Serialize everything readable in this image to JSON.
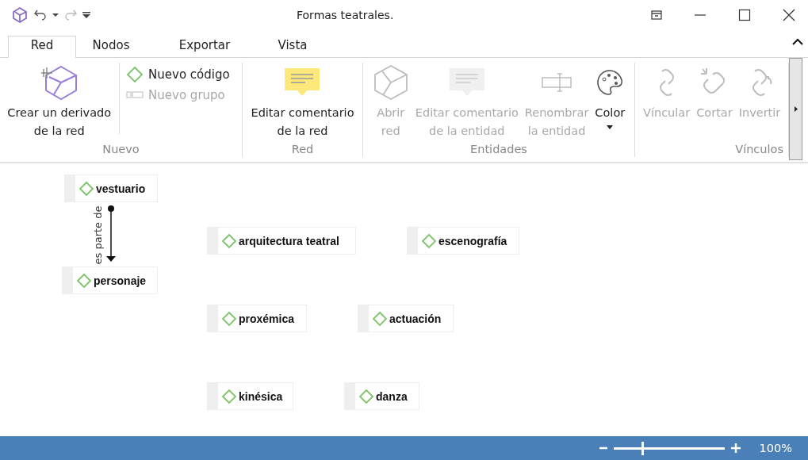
{
  "window": {
    "title": "Formas teatrales."
  },
  "tabs": [
    {
      "label": "Red",
      "selected": true
    },
    {
      "label": "Nodos",
      "selected": false
    },
    {
      "label": "Exportar",
      "selected": false
    },
    {
      "label": "Vista",
      "selected": false
    }
  ],
  "ribbon": {
    "groups": [
      {
        "label": "Nuevo",
        "items": [
          {
            "kind": "large",
            "label": "Crear un derivado\nde la red",
            "disabled": false
          },
          {
            "kind": "small",
            "label": "Nuevo código",
            "disabled": false
          },
          {
            "kind": "small",
            "label": "Nuevo grupo",
            "disabled": true
          }
        ]
      },
      {
        "label": "Red",
        "items": [
          {
            "kind": "large",
            "label": "Editar comentario\nde la red",
            "disabled": false
          }
        ]
      },
      {
        "label": "Entidades",
        "items": [
          {
            "kind": "large",
            "label": "Abrir\nred",
            "disabled": true
          },
          {
            "kind": "large",
            "label": "Editar comentario\nde la entidad",
            "disabled": true
          },
          {
            "kind": "large",
            "label": "Renombrar\nla entidad",
            "disabled": true
          },
          {
            "kind": "large",
            "label": "Color",
            "disabled": false,
            "dropdown": true
          }
        ]
      },
      {
        "label": "Vínculos",
        "items": [
          {
            "kind": "large",
            "label": "Víncular",
            "disabled": true
          },
          {
            "kind": "large",
            "label": "Cortar",
            "disabled": true
          },
          {
            "kind": "large",
            "label": "Invertir",
            "disabled": true
          }
        ]
      }
    ]
  },
  "nodes": [
    {
      "label": "vestuario"
    },
    {
      "label": "personaje"
    },
    {
      "label": "arquitectura teatral"
    },
    {
      "label": "escenografía"
    },
    {
      "label": "proxémica"
    },
    {
      "label": "actuación"
    },
    {
      "label": "kinésica"
    },
    {
      "label": "danza"
    }
  ],
  "links": [
    {
      "label": "es parte de"
    }
  ],
  "status_bar": {
    "zoom": {
      "level": 0.26,
      "reading": "100%"
    }
  }
}
